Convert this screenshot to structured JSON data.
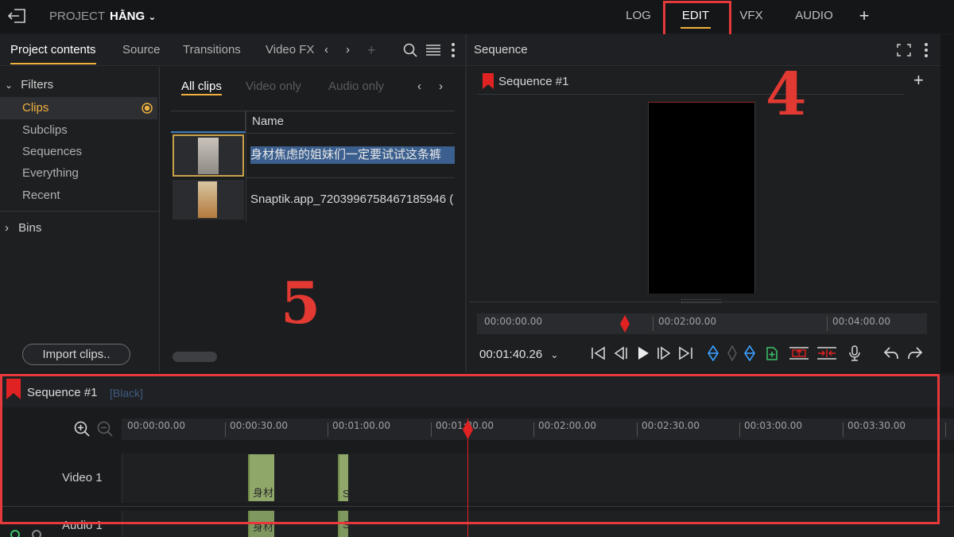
{
  "topbar": {
    "project_label": "PROJECT",
    "project_name": "HẰNG",
    "tabs": [
      {
        "label": "LOG"
      },
      {
        "label": "EDIT"
      },
      {
        "label": "VFX"
      },
      {
        "label": "AUDIO"
      }
    ],
    "active_tab": "EDIT"
  },
  "project_panel": {
    "tabs": [
      "Project contents",
      "Source",
      "Transitions",
      "Video FX"
    ],
    "filters_label": "Filters",
    "filters": [
      "Clips",
      "Subclips",
      "Sequences",
      "Everything",
      "Recent"
    ],
    "bins_label": "Bins",
    "import_button": "Import clips..",
    "sub_tabs": [
      "All clips",
      "Video only",
      "Audio only"
    ],
    "column_name": "Name",
    "clips": [
      {
        "name": "身材焦虑的姐妹们一定要试试这条裤"
      },
      {
        "name": "Snaptik.app_7203996758467185946 ("
      }
    ]
  },
  "sequence_panel": {
    "title": "Sequence",
    "sequence_name": "Sequence #1",
    "ruler": [
      "00:00:00.00",
      "00:02:00.00",
      "00:04:00.00"
    ],
    "current_time": "00:01:40.26"
  },
  "timeline": {
    "sequence_name": "Sequence #1",
    "sequence_tag": "[Black]",
    "ruler": [
      "00:00:00.00",
      "00:00:30.00",
      "00:01:00.00",
      "00:01:30.00",
      "00:02:00.00",
      "00:02:30.00",
      "00:03:00.00",
      "00:03:30.00"
    ],
    "tracks": [
      "Video 1",
      "Audio 1"
    ],
    "clip_labels": [
      "身材",
      "S"
    ]
  },
  "annotations": {
    "number_4": "4",
    "number_5": "5"
  },
  "colors": {
    "accent": "#f0b13c",
    "annotation_red": "#e5393b",
    "clip_green": "#8fa86a"
  }
}
